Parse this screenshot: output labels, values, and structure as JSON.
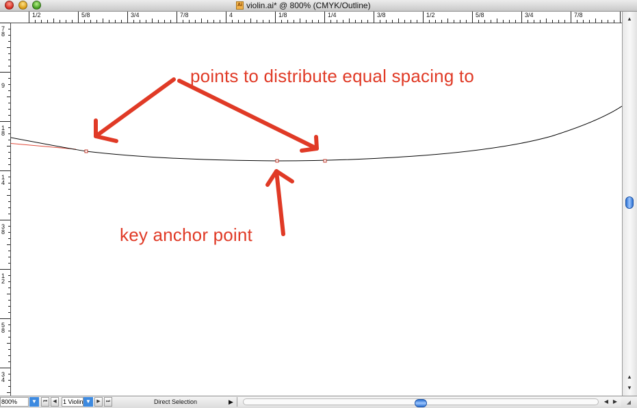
{
  "window": {
    "title": "violin.ai* @ 800% (CMYK/Outline)",
    "doc_icon_glyph": "Ai",
    "icons": [
      "close-button",
      "minimize-button",
      "zoom-button",
      "illustrator-doc-icon"
    ]
  },
  "rulers": {
    "top_labels": [
      "1/2",
      "5/8",
      "3/4",
      "7/8",
      "4",
      "1/8",
      "1/4",
      "3/8",
      "1/2",
      "5/8",
      "3/4",
      "7/8"
    ],
    "left_labels": [
      [
        "7",
        "8"
      ],
      [
        "9"
      ],
      [
        "1",
        "8"
      ],
      [
        "1",
        "4"
      ],
      [
        "3",
        "8"
      ],
      [
        "1",
        "2"
      ],
      [
        "5",
        "8"
      ],
      [
        "3",
        "4"
      ]
    ]
  },
  "annotations": {
    "top_text": "points to distribute equal spacing to",
    "bottom_text": "key anchor point",
    "color": "#e03a26"
  },
  "artwork": {
    "curve_color": "#000000",
    "guide_color": "#e04a3a",
    "anchor_color": "#c0392b"
  },
  "statusbar": {
    "zoom": "800%",
    "artboard": "1 Violin",
    "tool": "Direct Selection",
    "dropdown_icon": "▼",
    "first_icon": "⏮",
    "prev_icon": "◀",
    "next_icon": "▶",
    "last_icon": "⏭",
    "menu_arrow": "▶",
    "scroll_left_icon": "◀",
    "scroll_right_icon": "▶",
    "resize_icon": "◢"
  },
  "vscroll": {
    "up_icon": "▲",
    "down_icon": "▼",
    "top_icon": "▲"
  }
}
